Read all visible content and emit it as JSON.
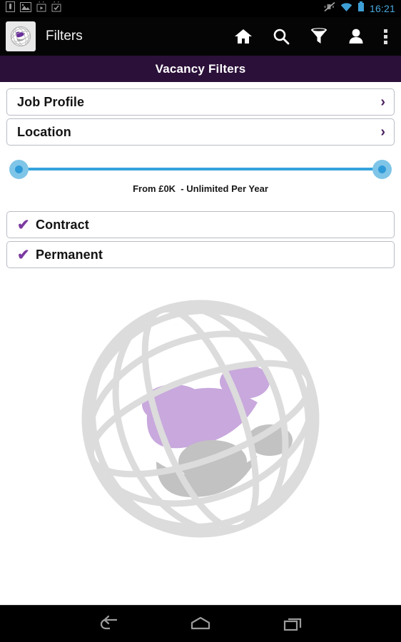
{
  "status_bar": {
    "icons_left": [
      "sim-card-icon",
      "gallery-icon",
      "play-store-icon",
      "tasks-icon"
    ],
    "icons_right": [
      "vibrate-off-icon",
      "wifi-icon",
      "battery-icon"
    ],
    "time": "16:21"
  },
  "action_bar": {
    "logo_icon": "globe-logo-icon",
    "title": "Filters",
    "icons": [
      {
        "name": "home-icon"
      },
      {
        "name": "search-icon"
      },
      {
        "name": "filter-funnel-icon"
      },
      {
        "name": "person-icon"
      },
      {
        "name": "overflow-menu-icon"
      }
    ]
  },
  "page": {
    "title": "Vacancy Filters",
    "title_bg": "#2b1039"
  },
  "filters": {
    "nav_rows": [
      {
        "label": "Job Profile",
        "chevron": "›"
      },
      {
        "label": "Location",
        "chevron": "›"
      }
    ],
    "salary_slider": {
      "caption": "From £0K  - Unlimited Per Year",
      "min_label": "£0K",
      "max_label": "Unlimited",
      "min_percent": 0,
      "max_percent": 100,
      "track_color": "#35a3dd",
      "thumb_color": "#7fc5e8"
    },
    "contract_types": [
      {
        "label": "Contract",
        "checked": true,
        "mark": "✔"
      },
      {
        "label": "Permanent",
        "checked": true,
        "mark": "✔"
      }
    ],
    "accent_color": "#7b3aa0"
  },
  "watermark": {
    "name": "globe-people-watermark"
  },
  "nav_bar": {
    "buttons": [
      {
        "name": "back-button"
      },
      {
        "name": "home-button"
      },
      {
        "name": "recents-button"
      }
    ]
  }
}
